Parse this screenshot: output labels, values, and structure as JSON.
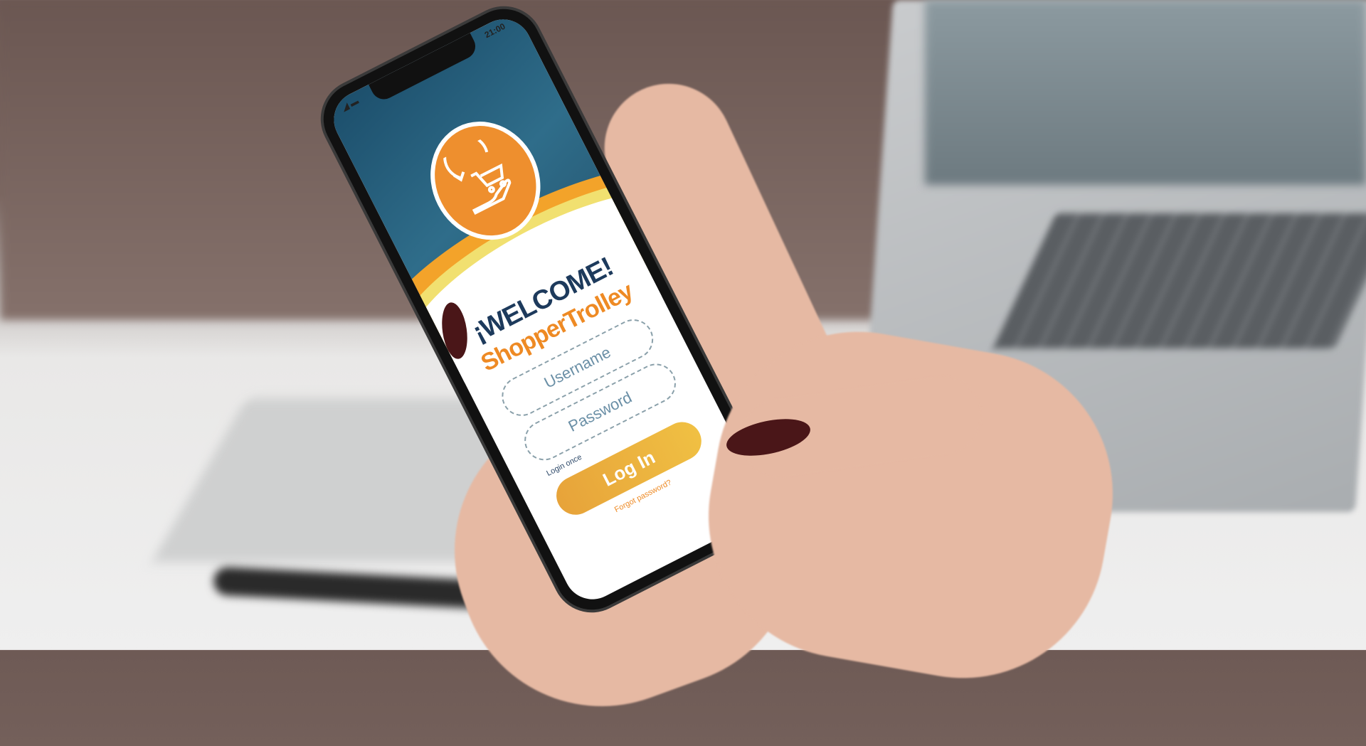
{
  "status_bar": {
    "time": "21:00"
  },
  "app": {
    "welcome": "¡WELCOME!",
    "brand": "ShopperTrolley",
    "username_placeholder": "Username",
    "password_placeholder": "Password",
    "login_once": "Login once",
    "login_button": "Log In",
    "forgot_password": "Forgot password?"
  },
  "colors": {
    "accent": "#ee8a24",
    "navy": "#1d3a5c",
    "hero": "#2f6d8a",
    "button": "#e7a33a"
  }
}
